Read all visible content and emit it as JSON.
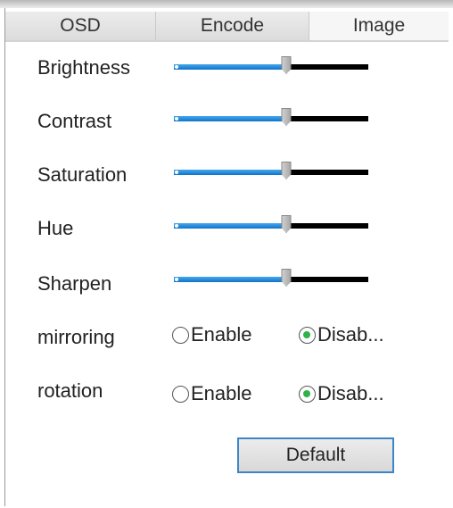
{
  "tabs": [
    {
      "label": "OSD",
      "active": false
    },
    {
      "label": "Encode",
      "active": false
    },
    {
      "label": "Image",
      "active": true
    }
  ],
  "sliders": [
    {
      "label": "Brightness",
      "value_fraction": 0.58
    },
    {
      "label": "Contrast",
      "value_fraction": 0.58
    },
    {
      "label": "Saturation",
      "value_fraction": 0.58
    },
    {
      "label": "Hue",
      "value_fraction": 0.58
    },
    {
      "label": "Sharpen",
      "value_fraction": 0.58
    }
  ],
  "mirroring": {
    "label": "mirroring",
    "enable_label": "Enable",
    "disable_label": "Disab...",
    "selected": "disable"
  },
  "rotation": {
    "label": "rotation",
    "enable_label": "Enable",
    "disable_label": "Disab...",
    "selected": "disable"
  },
  "default_button": "Default",
  "colors": {
    "slider_fill": "#2a8ee0",
    "slider_track": "#000000",
    "radio_selected": "#2fb24a",
    "button_border": "#3c86c8"
  }
}
